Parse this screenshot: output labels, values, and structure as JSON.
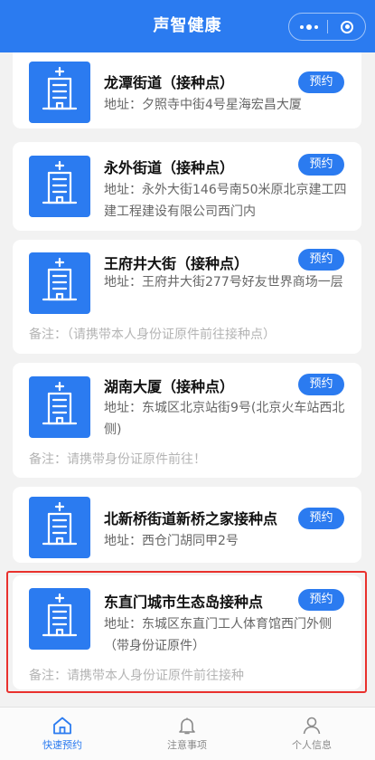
{
  "header": {
    "title": "声智健康"
  },
  "cards": [
    {
      "name": "龙潭街道（接种点）",
      "address": "地址：夕照寺中街4号星海宏昌大厦",
      "note": "",
      "button": "预约"
    },
    {
      "name": "永外街道（接种点）",
      "address": "地址：永外大街146号南50米原北京建工四建工程建设有限公司西门内",
      "note": "",
      "button": "预约"
    },
    {
      "name": "王府井大街（接种点）",
      "address": "地址：王府井大街277号好友世界商场一层",
      "note": "备注：（请携带本人身份证原件前往接种点）",
      "button": "预约"
    },
    {
      "name": "湖南大厦（接种点）",
      "address": "地址：东城区北京站街9号(北京火车站西北侧)",
      "note": "备注：请携带身份证原件前往！",
      "button": "预约"
    },
    {
      "name": "北新桥街道新桥之家接种点",
      "address": "地址：西仓门胡同甲2号",
      "note": "",
      "button": "预约"
    },
    {
      "name": "东直门城市生态岛接种点",
      "address": "地址：东城区东直门工人体育馆西门外侧（带身份证原件）",
      "note": "备注：请携带本人身份证原件前往接种",
      "button": "预约"
    }
  ],
  "tabbar": {
    "tabs": [
      {
        "label": "快速预约",
        "icon": "home-icon",
        "active": true
      },
      {
        "label": "注意事项",
        "icon": "bell-icon",
        "active": false
      },
      {
        "label": "个人信息",
        "icon": "person-icon",
        "active": false
      }
    ]
  },
  "colors": {
    "primary": "#2b7bf0",
    "highlight_border": "#e9312d",
    "background": "#f2f2f2"
  }
}
